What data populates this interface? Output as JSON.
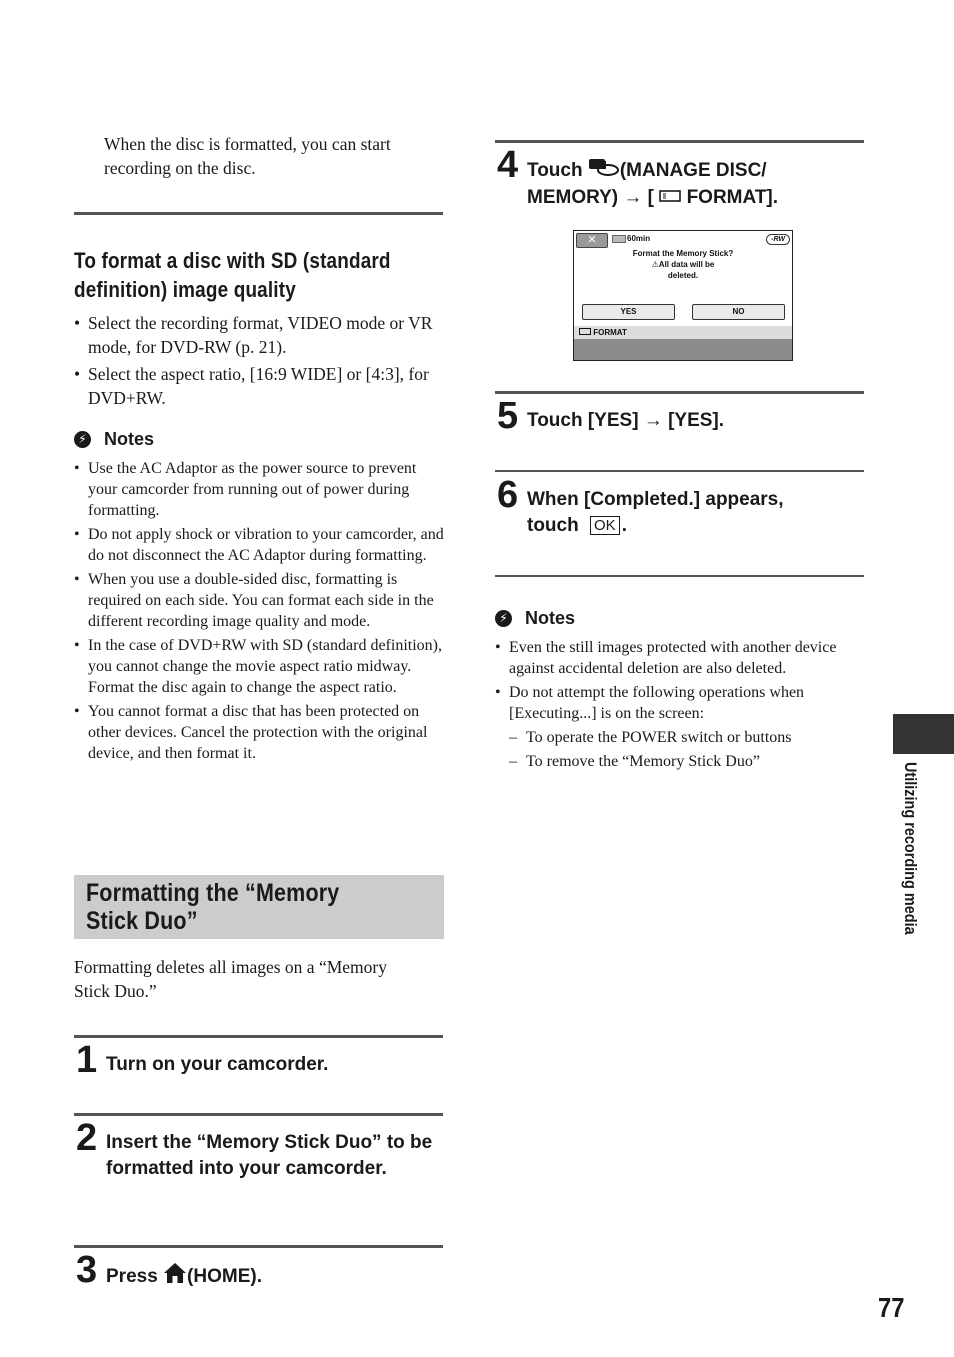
{
  "left_column": {
    "intro_text": "When the disc is formatted, you can start recording on the disc.",
    "sd_section": {
      "heading": "To format a disc with SD (standard definition) image quality",
      "bullets": [
        "Select the recording format, VIDEO mode or VR mode, for DVD-RW (p. 21).",
        "Select the aspect ratio, [16:9 WIDE] or [4:3], for DVD+RW."
      ]
    },
    "notes": {
      "title": "Notes",
      "icon": "notes-icon",
      "items": [
        "Use the AC Adaptor as the power source to prevent your camcorder from running out of power during formatting.",
        "Do not apply shock or vibration to your camcorder, and do not disconnect the AC Adaptor during formatting.",
        "When you use a double-sided disc, formatting is required on each side. You can format each side in the different recording image quality and mode.",
        "In the case of DVD+RW with SD (standard definition), you cannot change the movie aspect ratio midway. Format the disc again to change the aspect ratio.",
        "You cannot format a disc that has been protected on other devices. Cancel the protection with the original device, and then format it."
      ]
    },
    "memory_stick_section": {
      "heading": "Formatting the “Memory Stick Duo”",
      "intro": "Formatting deletes all images on a “Memory Stick Duo.”"
    },
    "steps": [
      {
        "number": "1",
        "text": "Turn on your camcorder."
      },
      {
        "number": "2",
        "text": "Insert the “Memory Stick Duo” to be formatted into your camcorder."
      },
      {
        "number": "3",
        "text_before": "Press ",
        "icon": "home-icon",
        "text_after": "(HOME)."
      }
    ]
  },
  "right_column": {
    "steps": [
      {
        "number": "4",
        "text_before": "Touch ",
        "icon": "manage-disc-memory-icon",
        "text_middle": "(MANAGE DISC/ MEMORY) → [",
        "icon2": "memory-stick-icon",
        "text_after": " FORMAT]."
      },
      {
        "number": "5",
        "text": "Touch [YES] → [YES]."
      },
      {
        "number": "6",
        "text_before": "When [Completed.] appears, touch ",
        "button_label": "OK",
        "text_after": "."
      }
    ],
    "lcd_screen": {
      "close_label": "✕",
      "battery_time": "60min",
      "disc_badge": "-RW",
      "message_line1": "Format the Memory Stick?",
      "message_line2": "⚠All data will be",
      "message_line3": "deleted.",
      "yes_label": "YES",
      "no_label": "NO",
      "footer_label": "FORMAT"
    },
    "notes": {
      "title": "Notes",
      "items": [
        "Even the still images protected with another device against accidental deletion are also deleted.",
        "Do not attempt the following operations when [Executing...] is on the screen:"
      ],
      "sub_items": [
        "To operate the POWER switch or buttons",
        "To remove the “Memory Stick Duo”"
      ]
    }
  },
  "side_tab": {
    "label": "Utilizing recording media"
  },
  "page_number": "77"
}
